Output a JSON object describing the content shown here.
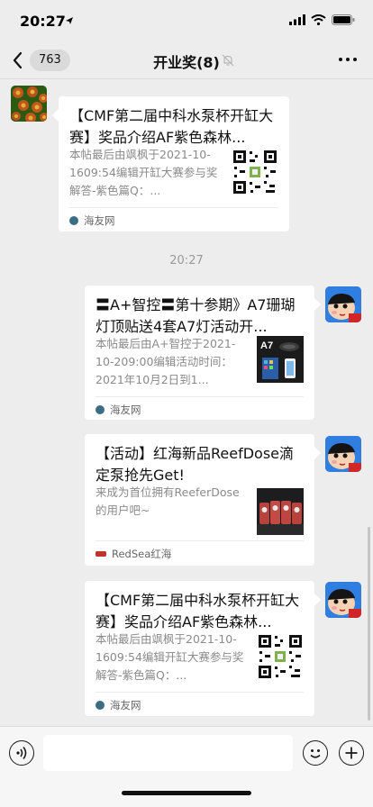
{
  "status_bar": {
    "time": "20:27"
  },
  "header": {
    "unread_count": "763",
    "title": "开业奖(8)"
  },
  "timestamp": "20:27",
  "messages": [
    {
      "title": "【CMF第二届中科水泵杯开缸大赛】奖品介绍AF紫色森林...",
      "description": "本帖最后由飒枫于2021-10-1609:54编辑开缸大赛参与奖解答-紫色篇Q：...",
      "source": "海友网",
      "thumb_icon": "qr-code-icon"
    },
    {
      "title": "〓A+智控〓第十参期》A7珊瑚灯顶贴送4套A7灯活动开...",
      "description": "本帖最后由A+智控于2021-10-209:00编辑活动时间：2021年10月2日到1...",
      "source": "海友网",
      "thumb_label": "A7"
    },
    {
      "title": "【活动】红海新品ReefDose滴定泵抢先Get!",
      "description": "来成为首位拥有ReeferDose的用户吧~",
      "source": "RedSea红海",
      "thumb_icon": "aquarium-pumps-photo"
    },
    {
      "title": "【CMF第二届中科水泵杯开缸大赛】奖品介绍AF紫色森林...",
      "description": "本帖最后由飒枫于2021-10-1609:54编辑开缸大赛参与奖解答-紫色篇Q：...",
      "source": "海友网",
      "thumb_icon": "qr-code-icon"
    }
  ],
  "input": {
    "placeholder": ""
  },
  "colors": {
    "background": "#ededed",
    "bubble": "#ffffff",
    "text_secondary": "#8a8a8a"
  }
}
